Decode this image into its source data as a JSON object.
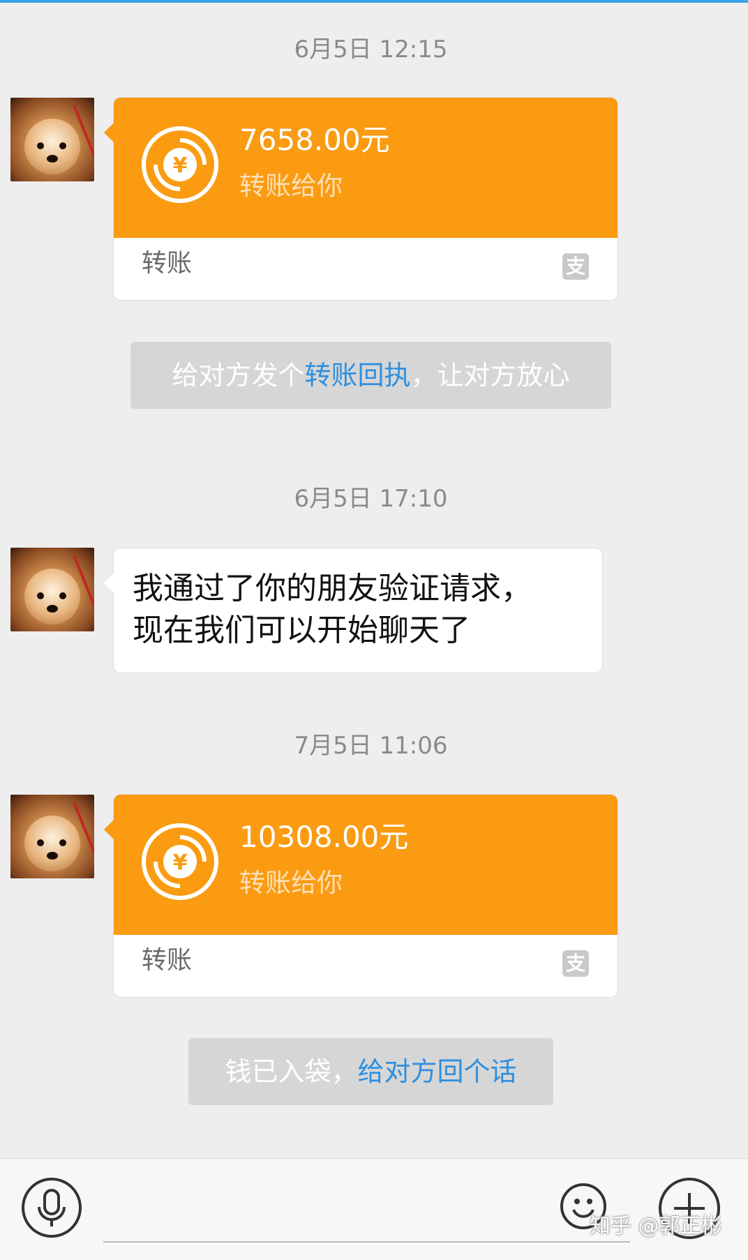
{
  "timestamps": [
    "6月5日 12:15",
    "6月5日 17:10",
    "7月5日 11:06"
  ],
  "transfers": [
    {
      "amount": "7658.00元",
      "subtitle": "转账给你",
      "label": "转账"
    },
    {
      "amount": "10308.00元",
      "subtitle": "转账给你",
      "label": "转账"
    }
  ],
  "notices": [
    {
      "pre": "给对方发个",
      "link": "转账回执",
      "post": "，让对方放心"
    },
    {
      "pre": "钱已入袋，",
      "link": "给对方回个话",
      "post": ""
    }
  ],
  "message": {
    "line1": "我通过了你的朋友验证请求，",
    "line2": "现在我们可以开始聊天了"
  },
  "icons": {
    "avatar": "dog-avatar",
    "coin": "yuan-transfer-icon",
    "alipay": "alipay-icon",
    "mic": "microphone-icon",
    "emoji": "emoji-icon",
    "plus": "plus-icon"
  },
  "alipay_glyph": "支",
  "watermark": "知乎 @郭正彬",
  "colors": {
    "orange": "#fa9b12",
    "link": "#2d8fe0",
    "background": "#eeeeee"
  }
}
